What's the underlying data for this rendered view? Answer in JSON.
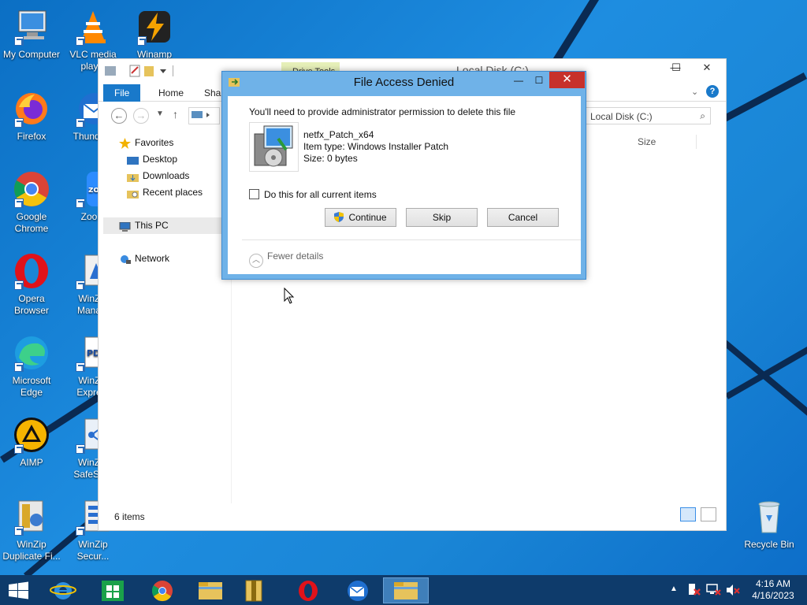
{
  "desktop_icons": [
    {
      "label": "My Computer",
      "icon": "computer-icon"
    },
    {
      "label": "VLC media play...",
      "icon": "vlc-icon"
    },
    {
      "label": "Winamp",
      "icon": "winamp-icon"
    },
    {
      "label": "Firefox",
      "icon": "firefox-icon"
    },
    {
      "label": "Thunde...",
      "icon": "thunderbird-icon"
    },
    {
      "label": "Google Chrome",
      "icon": "chrome-icon"
    },
    {
      "label": "Zoo...",
      "icon": "zoom-icon"
    },
    {
      "label": "Opera Browser",
      "icon": "opera-icon"
    },
    {
      "label": "WinZip Mana...",
      "icon": "winzip-manager-icon"
    },
    {
      "label": "Microsoft Edge",
      "icon": "edge-icon"
    },
    {
      "label": "WinZip Expre...",
      "icon": "winzip-pdf-icon"
    },
    {
      "label": "AIMP",
      "icon": "aimp-icon"
    },
    {
      "label": "WinZ... SafeSh...",
      "icon": "winzip-safeshare-icon"
    },
    {
      "label": "WinZip Duplicate Fi...",
      "icon": "winzip-duplicate-icon"
    },
    {
      "label": "WinZip Secur...",
      "icon": "winzip-secure-icon"
    },
    {
      "label": "Recycle Bin",
      "icon": "recycle-bin-icon"
    }
  ],
  "explorer": {
    "title": "Local Disk (C:)",
    "drive_tools": "Drive Tools",
    "ribbon_tabs": [
      "File",
      "Home",
      "Shar..."
    ],
    "search_placeholder": "Local Disk (C:)",
    "nav": {
      "favorites": "Favorites",
      "desktop": "Desktop",
      "downloads": "Downloads",
      "recent": "Recent places",
      "this_pc": "This PC",
      "network": "Network"
    },
    "column_size": "Size",
    "status": "6 items"
  },
  "dialog": {
    "title": "File Access Denied",
    "message": "You'll need to provide administrator permission to delete this file",
    "file_name": "netfx_Patch_x64",
    "item_type": "Item type: Windows Installer Patch",
    "size": "Size: 0 bytes",
    "checkbox_label": "Do this for all current items",
    "continue_label": "Continue",
    "skip_label": "Skip",
    "cancel_label": "Cancel",
    "fewer_details": "Fewer details"
  },
  "taskbar": {
    "time": "4:16 AM",
    "date": "4/16/2023"
  },
  "colors": {
    "accent": "#1979ca",
    "close_red": "#c7312b",
    "taskbar": "#0e3b6b"
  }
}
